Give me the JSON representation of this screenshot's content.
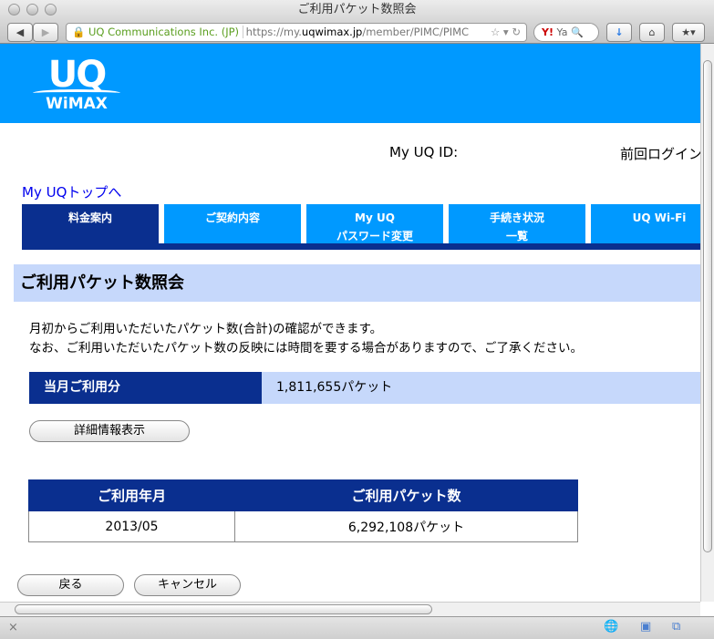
{
  "browser": {
    "window_title": "ご利用パケット数照会",
    "site_identity": "UQ Communications Inc. (JP)",
    "url_prefix": "https://my.",
    "url_domain": "uqwimax.jp",
    "url_path": "/member/PIMC/PIMC",
    "search_placeholder": "Ya"
  },
  "header": {
    "logo_top": "UQ",
    "logo_bottom": "WiMAX"
  },
  "user": {
    "id_label": "My UQ ID:",
    "last_login_label": "前回ログイン"
  },
  "nav": {
    "top_link": "My UQトップへ",
    "tabs": [
      {
        "line1": "料金案内",
        "line2": ""
      },
      {
        "line1": "ご契約内容",
        "line2": ""
      },
      {
        "line1": "My UQ",
        "line2": "パスワード変更"
      },
      {
        "line1": "手続き状況",
        "line2": "一覧"
      },
      {
        "line1": "UQ Wi-Fi",
        "line2": ""
      }
    ]
  },
  "page": {
    "title": "ご利用パケット数照会",
    "desc1": "月初からご利用いただいたパケット数(合計)の確認ができます。",
    "desc2": "なお、ご利用いただいたパケット数の反映には時間を要する場合がありますので、ご了承ください。"
  },
  "usage": {
    "label": "当月ご利用分",
    "value": "1,811,655パケット"
  },
  "detail_button": "詳細情報表示",
  "history": {
    "headers": [
      "ご利用年月",
      "ご利用パケット数"
    ],
    "rows": [
      [
        "2013/05",
        "6,292,108パケット"
      ]
    ]
  },
  "buttons": {
    "back": "戻る",
    "cancel": "キャンセル"
  },
  "colors": {
    "brand_blue": "#0099ff",
    "navy": "#0a2f8f",
    "section_bg": "#c6d8fb"
  }
}
